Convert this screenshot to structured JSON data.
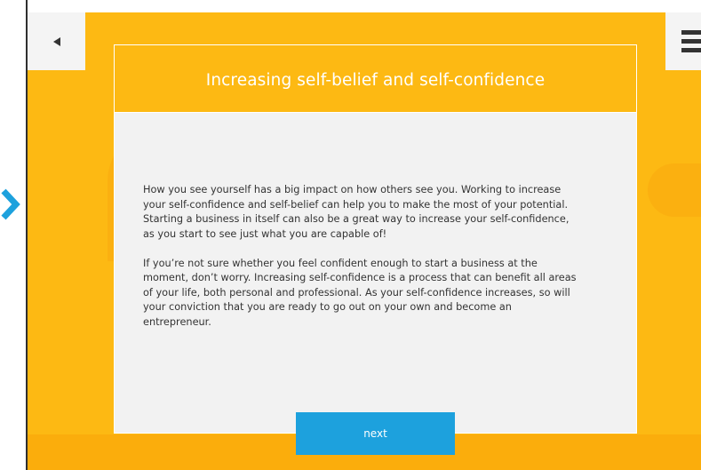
{
  "app": {
    "accent_color": "#fdb913",
    "button_color": "#1da1dd"
  },
  "navigation": {
    "back_icon": "triangle-left-icon",
    "menu_icon": "hamburger-menu-icon",
    "side_arrow_icon": "chevron-right-icon"
  },
  "card": {
    "title": "Increasing self-belief and self-confidence",
    "paragraphs": [
      "How you see yourself has a big impact on how others see you. Working to increase\nyour self-confidence and self-belief can help you to make the most of your potential.\nStarting a business in itself can also be a great way to increase your self-confidence,\nas you start to see just what you are capable of!",
      "If you’re not sure whether you feel confident enough to start a business at the\nmoment, don’t worry. Increasing self-confidence is a process that can benefit all areas\n of your life, both personal and professional. As your self-confidence increases, so will\n your conviction that you are ready to go out on your own and become an\nentrepreneur."
    ],
    "next_label": "next"
  }
}
